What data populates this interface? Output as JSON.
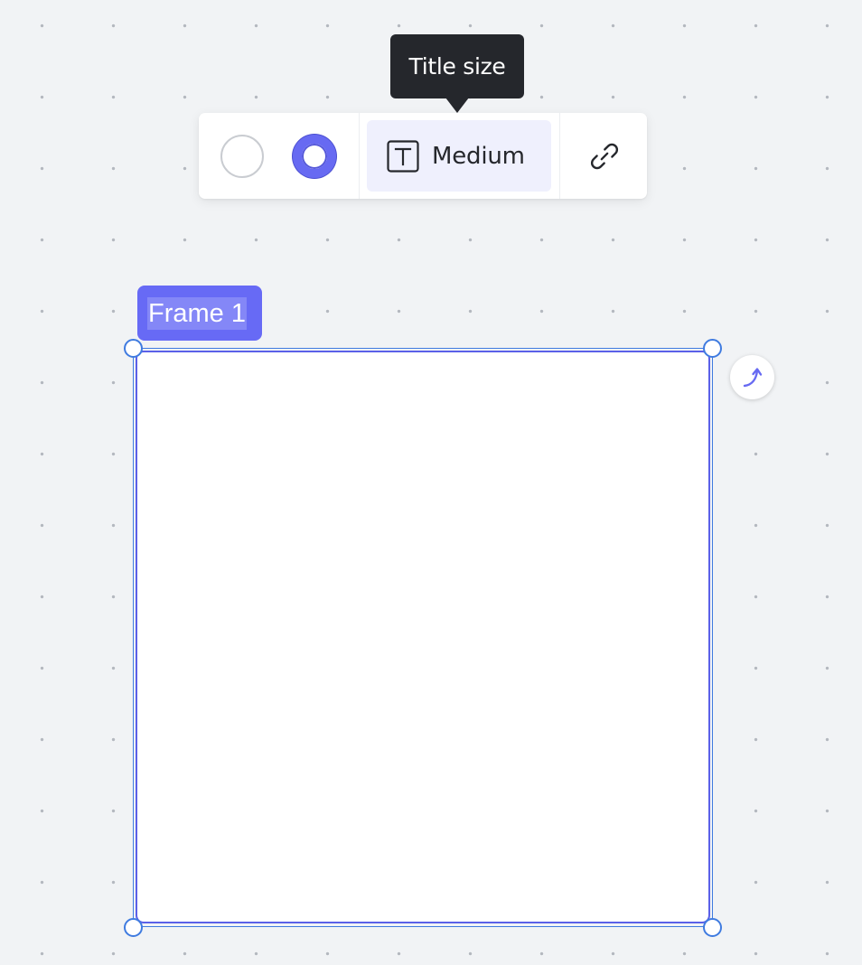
{
  "tooltip": {
    "text": "Title size"
  },
  "toolbar": {
    "swatches": [
      {
        "name": "white",
        "color": "#ffffff",
        "selected": false
      },
      {
        "name": "indigo",
        "color": "#676af2",
        "selected": true
      }
    ],
    "title_size": {
      "icon": "text-size-icon",
      "label": "Medium"
    },
    "link": {
      "icon": "link-icon"
    }
  },
  "frame": {
    "title": "Frame 1",
    "accent_color": "#676af5",
    "selection_color": "#3f7be0",
    "rotate_icon": "rotate-arrow-icon"
  }
}
